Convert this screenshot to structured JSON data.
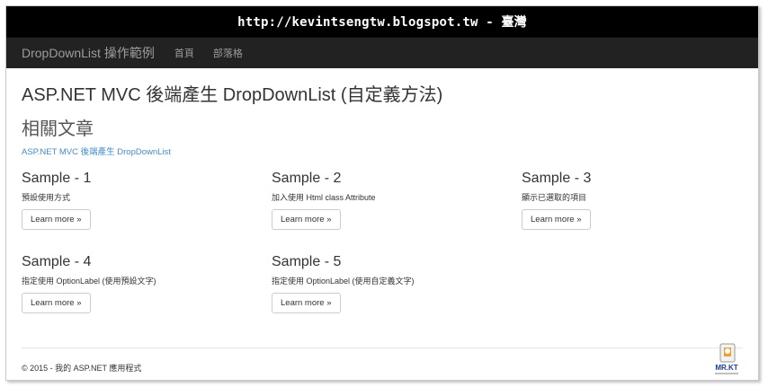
{
  "banner": {
    "url": "http://kevintsengtw.blogspot.tw - 臺灣"
  },
  "navbar": {
    "brand": "DropDownList 操作範例",
    "links": [
      "首頁",
      "部落格"
    ]
  },
  "page": {
    "title": "ASP.NET MVC 後端產生 DropDownList (自定義方法)",
    "related_heading": "相關文章",
    "related_link": "ASP.NET MVC 後端產生 DropDownList"
  },
  "samples": [
    {
      "title": "Sample - 1",
      "desc": "預設使用方式",
      "button": "Learn more »"
    },
    {
      "title": "Sample - 2",
      "desc": "加入使用 Html class Attribute",
      "button": "Learn more »"
    },
    {
      "title": "Sample - 3",
      "desc": "顯示已選取的項目",
      "button": "Learn more »"
    },
    {
      "title": "Sample - 4",
      "desc": "指定使用 OptionLabel (使用預設文字)",
      "button": "Learn more »"
    },
    {
      "title": "Sample - 5",
      "desc": "指定使用 OptionLabel (使用自定義文字)",
      "button": "Learn more »"
    }
  ],
  "footer": {
    "text": "© 2015 - 我的 ASP.NET 應用程式"
  },
  "watermark": {
    "logo_text": "MR.KT",
    "icon": "mr-kt-logo-icon"
  },
  "colors": {
    "navbar_bg": "#222222",
    "link": "#428bca",
    "banner_bg": "#000000"
  }
}
